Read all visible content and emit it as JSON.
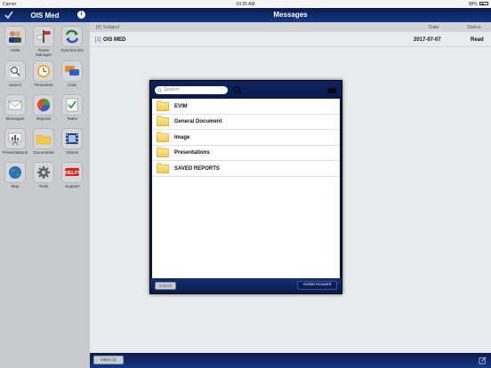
{
  "status_bar": {
    "carrier": "Carrier",
    "time": "10:26 AM",
    "battery": "38%"
  },
  "sidebar": {
    "title": "OIS Med",
    "info_glyph": "i",
    "items": [
      {
        "label": "Visits",
        "icon": "visits-icon"
      },
      {
        "label": "Route Manager",
        "icon": "route-manager-icon"
      },
      {
        "label": "Synchronize",
        "icon": "synchronize-icon"
      },
      {
        "label": "Search",
        "icon": "search-icon"
      },
      {
        "label": "Timesheet",
        "icon": "timesheet-icon"
      },
      {
        "label": "Chat",
        "icon": "chat-icon"
      },
      {
        "label": "Messages",
        "icon": "messages-icon"
      },
      {
        "label": "Reports",
        "icon": "reports-icon"
      },
      {
        "label": "Tasks",
        "icon": "tasks-icon"
      },
      {
        "label": "Presentations",
        "icon": "presentations-icon"
      },
      {
        "label": "Documents",
        "icon": "documents-icon"
      },
      {
        "label": "Videos",
        "icon": "videos-icon"
      },
      {
        "label": "Map",
        "icon": "map-icon"
      },
      {
        "label": "Tools",
        "icon": "tools-icon"
      },
      {
        "label": "Support",
        "icon": "support-icon"
      }
    ]
  },
  "main": {
    "title": "Messages",
    "columns": {
      "num": "[#]",
      "subject": "Subject",
      "date": "Date",
      "status": "Status"
    },
    "rows": [
      {
        "num": "[1]",
        "subject": "OIS MED",
        "date": "2017-07-07",
        "status": "Read"
      }
    ]
  },
  "bottom_bar": {
    "left_button": "Inbox (1)"
  },
  "dialog": {
    "search_placeholder": "Search",
    "folders": [
      "EVIM",
      "General Document",
      "Image",
      "Presentations",
      "SAVED REPORTS"
    ],
    "cancel_label": "Cancel",
    "active_account_label": "Active Account"
  },
  "colors": {
    "nav": "#0b1a4a",
    "accent": "#2d5fc4"
  }
}
